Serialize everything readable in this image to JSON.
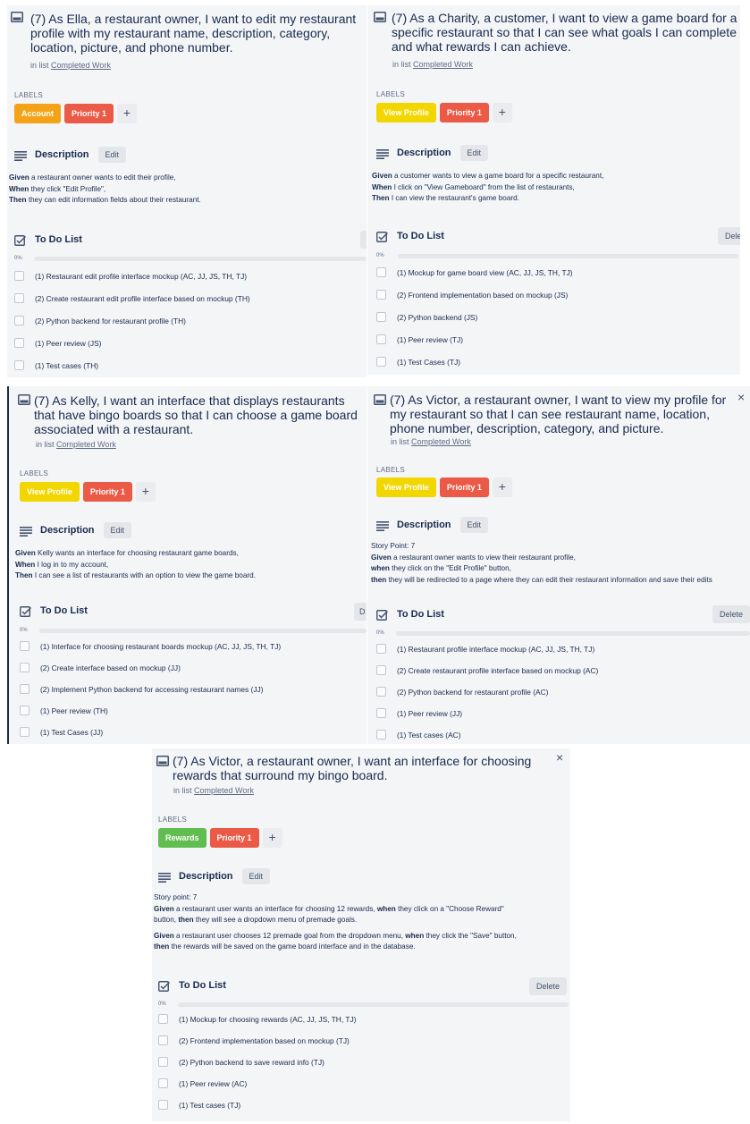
{
  "colors": {
    "orange": "#f4a318",
    "red": "#eb5a46",
    "yellow": "#f2d600",
    "green": "#61bd4f",
    "card_bg": "#f4f5f7",
    "progress": "#5ba4cf"
  },
  "cards": [
    {
      "title": "(7) As Ella, a restaurant owner, I want to edit my restaurant profile with my restaurant name, description, category, location, picture, and phone number.",
      "in_list_prefix": "in list",
      "list_name": "Completed Work",
      "labels_heading": "LABELS",
      "labels": [
        {
          "text": "Account",
          "color": "#f4a318"
        },
        {
          "text": "Priority 1",
          "color": "#eb5a46"
        }
      ],
      "add_label": "+",
      "description_heading": "Description",
      "edit_label": "Edit",
      "description": [
        {
          "lines": [
            {
              "bold": "Given",
              "rest": " a restaurant owner wants to edit their profile,"
            },
            {
              "bold": "When",
              "rest": " they click \"Edit Profile\","
            },
            {
              "bold": "Then",
              "rest": " they can edit information fields about their restaurant."
            }
          ]
        }
      ],
      "todo_heading": "To Do List",
      "delete_label": "",
      "progress_text": "0%",
      "progress": 0,
      "items": [
        "(1) Restaurant edit profile interface mockup (AC, JJ, JS, TH, TJ)",
        "(2) Create restaurant edit profile interface based on mockup (TH)",
        "(2) Python backend for restaurant profile (TH)",
        "(1) Peer review (JS)",
        "(1) Test cases (TH)"
      ]
    },
    {
      "title": "(7) As a Charity, a customer, I want to view a game board for a specific restaurant so that I can see what goals I can complete and what rewards I can achieve.",
      "in_list_prefix": "in list",
      "list_name": "Completed Work",
      "labels_heading": "LABELS",
      "labels": [
        {
          "text": "View Profile",
          "color": "#f2d600"
        },
        {
          "text": "Priority 1",
          "color": "#eb5a46"
        }
      ],
      "add_label": "+",
      "description_heading": "Description",
      "edit_label": "Edit",
      "description": [
        {
          "lines": [
            {
              "bold": "Given",
              "rest": " a customer wants to view a game board for a specific restaurant,"
            },
            {
              "bold": "When",
              "rest": " I click on \"View Gameboard\" from the list of restaurants,"
            },
            {
              "bold": "Then",
              "rest": " I can view the restaurant's game board."
            }
          ]
        }
      ],
      "todo_heading": "To Do List",
      "delete_label": "Dele",
      "progress_text": "0%",
      "progress": 0,
      "items": [
        "(1) Mockup for game board view (AC, JJ, JS, TH, TJ)",
        "(2) Frontend implementation based on mockup (JS)",
        "(2) Python backend (JS)",
        "(1) Peer review (TJ)",
        "(1) Test Cases (TJ)"
      ]
    },
    {
      "title": "(7) As Kelly, I want an interface that displays restaurants that have bingo boards so that I can choose a game board associated with a restaurant.",
      "in_list_prefix": "in list",
      "list_name": "Completed Work",
      "labels_heading": "LABELS",
      "labels": [
        {
          "text": "View Profile",
          "color": "#f2d600"
        },
        {
          "text": "Priority 1",
          "color": "#eb5a46"
        }
      ],
      "add_label": "+",
      "description_heading": "Description",
      "edit_label": "Edit",
      "description": [
        {
          "lines": [
            {
              "bold": "Given",
              "rest": " Kelly wants an interface for choosing restaurant game boards,"
            },
            {
              "bold": "When",
              "rest": " I log in to my account,"
            },
            {
              "bold": "Then",
              "rest": " I can see a list of restaurants with an option to view the game board."
            }
          ]
        }
      ],
      "todo_heading": "To Do List",
      "delete_label": "D",
      "progress_text": "0%",
      "progress": 0,
      "items": [
        "(1) Interface for choosing restaurant boards mockup (AC, JJ, JS, TH, TJ)",
        "(2) Create interface based on mockup (JJ)",
        "(2) Implement Python backend for accessing restaurant names (JJ)",
        "(1) Peer review (TH)",
        "(1) Test Cases (JJ)"
      ]
    },
    {
      "title": "(7) As Victor, a restaurant owner, I want to view my profile for my restaurant so that I can see restaurant name, location, phone number, description, category, and picture.",
      "in_list_prefix": "in list",
      "list_name": "Completed Work",
      "close": "×",
      "labels_heading": "LABELS",
      "labels": [
        {
          "text": "View Profile",
          "color": "#f2d600"
        },
        {
          "text": "Priority 1",
          "color": "#eb5a46"
        }
      ],
      "add_label": "+",
      "description_heading": "Description",
      "edit_label": "Edit",
      "description": [
        {
          "lines": [
            {
              "bold": "",
              "rest": "Story Point: 7"
            },
            {
              "bold": "Given",
              "rest": " a restaurant owner wants to view their restaurant profile,"
            },
            {
              "bold": "when",
              "rest": " they click on the \"Edit Profile\" button,"
            },
            {
              "bold": "then",
              "rest": " they will be redirected to a page where they can edit their restaurant information and save their edits"
            }
          ]
        }
      ],
      "todo_heading": "To Do List",
      "delete_label": "Delete",
      "progress_text": "0%",
      "progress": 0,
      "items": [
        "(1) Restaurant profile interface mockup (AC, JJ, JS, TH, TJ)",
        "(2) Create restaurant profile interface based on mockup (AC)",
        "(2) Python backend for restaurant profile (AC)",
        "(1) Peer review (JJ)",
        "(1) Test cases (AC)"
      ]
    },
    {
      "title": "(7) As Victor, a restaurant owner, I want an interface for choosing rewards that surround my bingo board.",
      "in_list_prefix": "in list",
      "list_name": "Completed Work",
      "close": "×",
      "labels_heading": "LABELS",
      "labels": [
        {
          "text": "Rewards",
          "color": "#61bd4f"
        },
        {
          "text": "Priority 1",
          "color": "#eb5a46"
        }
      ],
      "add_label": "+",
      "description_heading": "Description",
      "edit_label": "Edit",
      "description": [
        {
          "lines": [
            {
              "bold": "",
              "rest": "Story point: 7"
            },
            {
              "bold": "Given",
              "rest": " a restaurant user wants an interface for choosing 12 rewards, ",
              "bold2": "when",
              "rest2": " they click on a \"Choose Reward\""
            },
            {
              "bold": "",
              "rest": "button, ",
              "bold2": "then",
              "rest2": " they will see a dropdown menu of premade goals."
            }
          ]
        },
        {
          "lines": [
            {
              "bold": "Given",
              "rest": " a restaurant user chooses 12 premade goal from the dropdown menu, ",
              "bold2": "when",
              "rest2": " they click the \"Save\" button,"
            },
            {
              "bold": "then",
              "rest": " the rewards will be saved on the game board interface and in the database."
            }
          ]
        }
      ],
      "todo_heading": "To Do List",
      "delete_label": "Delete",
      "progress_text": "0%",
      "progress": 0,
      "items": [
        "(1) Mockup for choosing rewards (AC, JJ, JS, TH, TJ)",
        "(2) Frontend implementation based on mockup (TJ)",
        "(2) Python backend to save reward info (TJ)",
        "(1) Peer review (AC)",
        "(1) Test cases (TJ)"
      ]
    }
  ]
}
